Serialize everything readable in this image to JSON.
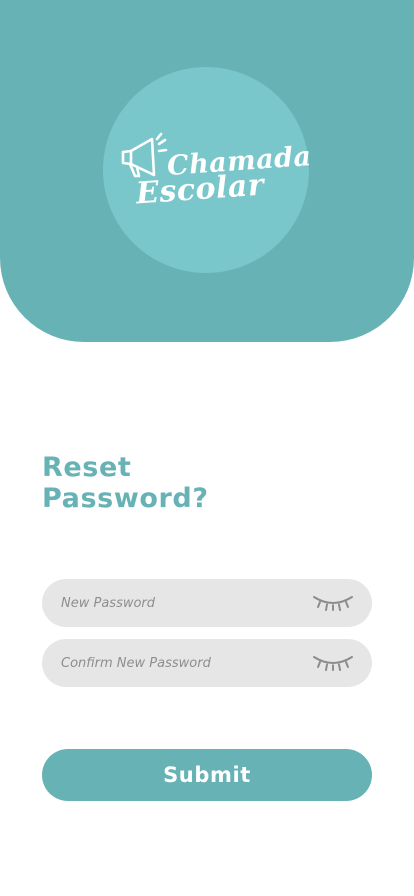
{
  "brand": {
    "logo_line1": "Chamada",
    "logo_line2": "Escolar",
    "logo_icon": "megaphone-icon",
    "header_color": "#67b2b5",
    "logo_circle_color": "#79c7ca"
  },
  "page": {
    "title_line1": "Reset",
    "title_line2": "Password?"
  },
  "form": {
    "new_password": {
      "placeholder": "New Password",
      "value": "",
      "toggle_icon": "eye-closed-icon"
    },
    "confirm_password": {
      "placeholder": "Confirm New Password",
      "value": "",
      "toggle_icon": "eye-closed-icon"
    },
    "submit_label": "Submit"
  }
}
